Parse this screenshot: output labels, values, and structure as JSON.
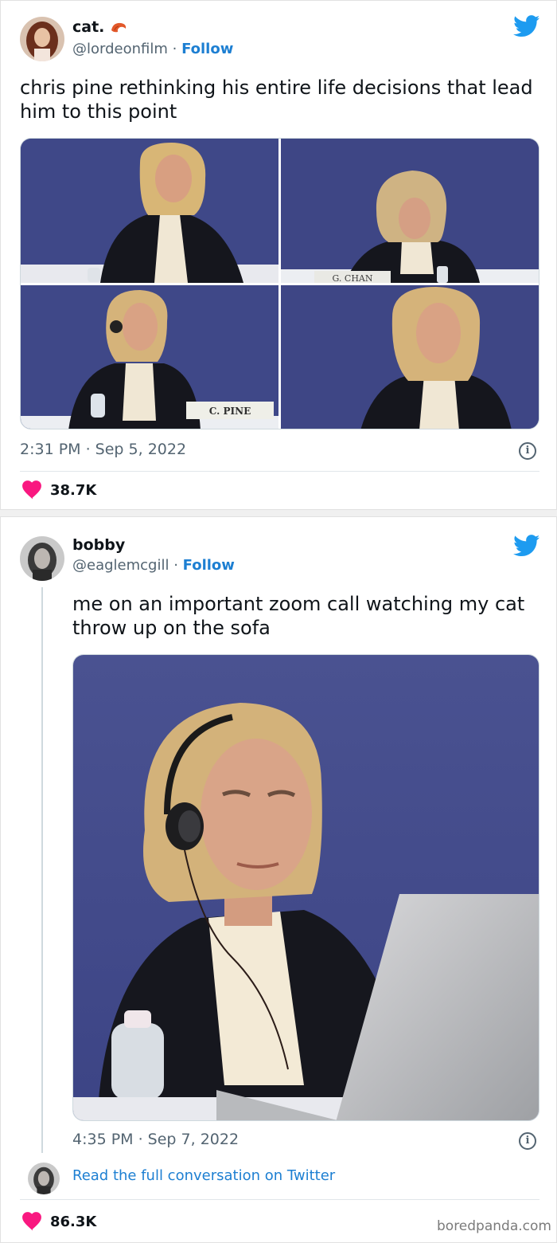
{
  "tweet1": {
    "display_name": "cat.",
    "handle": "@lordeonfilm",
    "separator": " · ",
    "follow_label": "Follow",
    "text": "chris pine rethinking his entire life decisions that lead him to this point",
    "images": [
      {
        "desc": "photo-top-left"
      },
      {
        "desc": "photo-top-right",
        "placard": "G. CHAN"
      },
      {
        "desc": "photo-bottom-left",
        "placard": "C. PINE"
      },
      {
        "desc": "photo-bottom-right"
      }
    ],
    "timestamp": "2:31 PM · Sep 5, 2022",
    "likes": "38.7K",
    "info_glyph": "i"
  },
  "tweet2": {
    "display_name": "bobby",
    "handle": "@eaglemcgill",
    "separator": " · ",
    "follow_label": "Follow",
    "text": "me on an important zoom call watching my cat throw up on the sofa",
    "timestamp": "4:35 PM · Sep 7, 2022",
    "read_more": "Read the full conversation on Twitter",
    "likes": "86.3K",
    "info_glyph": "i"
  },
  "watermark": "boredpanda.com",
  "colors": {
    "twitter_blue": "#1d9bf0",
    "link_blue": "#1d7fd2",
    "heart_pink": "#f91880",
    "backdrop_navy": "#3d4686"
  },
  "icons": [
    "twitter-bird-icon",
    "heart-icon",
    "info-icon",
    "shrimp-emoji-icon"
  ]
}
